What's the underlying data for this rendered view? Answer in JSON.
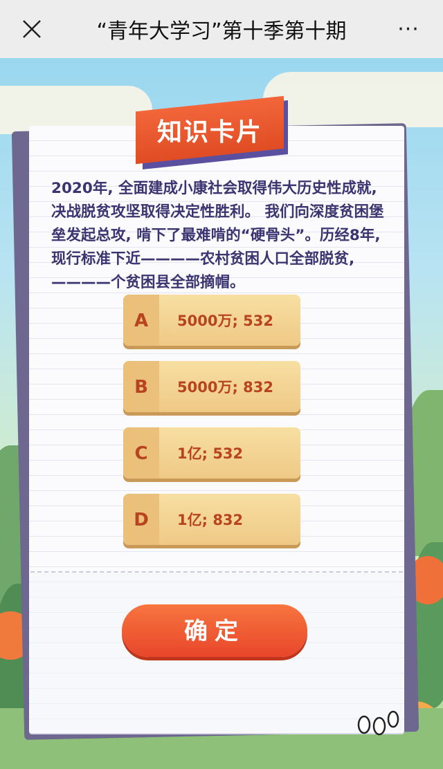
{
  "navbar": {
    "title": "“青年大学习”第十季第十期",
    "more_label": "···"
  },
  "card": {
    "ribbon_title": "知识卡片",
    "question_lines": [
      "2020年, 全面建成小康社会取得伟大历史性成就,",
      "决战脱贫攻坚取得决定性胜利。 我们向深度贫困堡",
      "垒发起总攻, 啃下了最难啃的“硬骨头”。历经8年,",
      "现行标准下近————农村贫困人口全部脱贫,",
      "————个贫困县全部摘帽。"
    ],
    "options": [
      {
        "letter": "A",
        "text": "5000万; 532"
      },
      {
        "letter": "B",
        "text": "5000万; 832"
      },
      {
        "letter": "C",
        "text": "1亿; 532"
      },
      {
        "letter": "D",
        "text": "1亿; 832"
      }
    ],
    "confirm_label": "确定"
  },
  "colors": {
    "accent_red": "#e8462a",
    "question_text": "#3a3470",
    "option_bg": "#f3d595",
    "option_text": "#b8431f"
  }
}
